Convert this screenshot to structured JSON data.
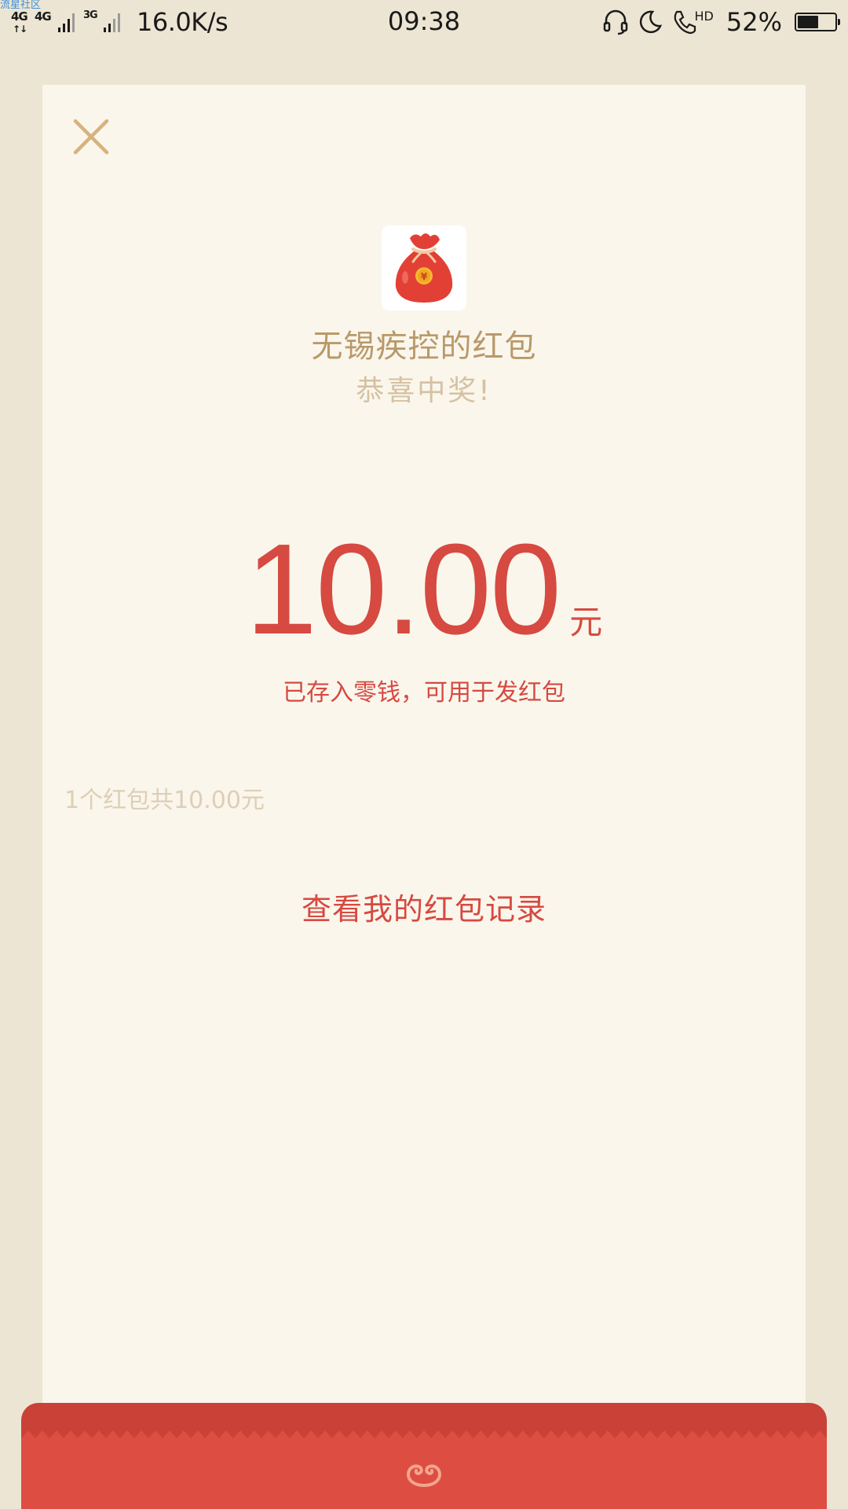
{
  "status_bar": {
    "watermark": "流星社区",
    "network1": "4G",
    "network2": "4G",
    "network3": "3G",
    "speed": "16.0K/s",
    "time": "09:38",
    "hd_label": "HD",
    "battery_percent": "52%",
    "battery_level": 0.52
  },
  "red_packet": {
    "sender_title": "无锡疾控的红包",
    "wish": "恭喜中奖!",
    "amount": "10.00",
    "unit": "元",
    "stored_note": "已存入零钱，可用于发红包",
    "summary": "1个红包共10.00元",
    "view_records_label": "查看我的红包记录"
  },
  "icons": {
    "close": "close-icon",
    "logo": "money-bag-icon",
    "headset": "headset-icon",
    "moon": "moon-icon",
    "phone": "phone-icon",
    "battery": "battery-icon",
    "ornament": "cloud-ornament-icon"
  },
  "colors": {
    "background": "#ede5d3",
    "card": "#faf6ec",
    "accent_red": "#d64a41",
    "gold_text": "#b9996a",
    "envelope_red": "#dd4d42"
  }
}
